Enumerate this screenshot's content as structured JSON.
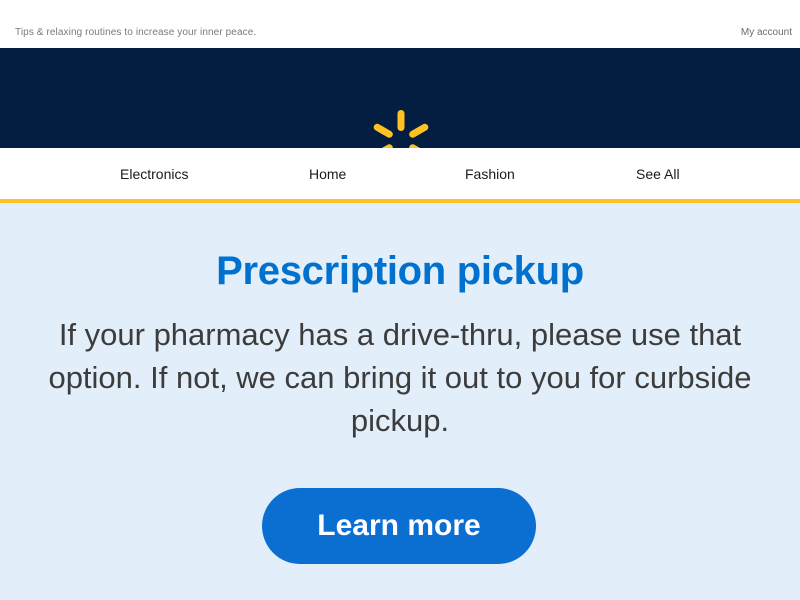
{
  "preheader": {
    "text": "Tips & relaxing routines to increase your inner peace.",
    "account_link": "My account"
  },
  "brand": {
    "logo_icon": "spark-icon",
    "background_color": "#041e42",
    "logo_color": "#ffc220"
  },
  "nav": {
    "accent_color": "#ffc220",
    "items": [
      {
        "label": "Electronics"
      },
      {
        "label": "Home"
      },
      {
        "label": "Fashion"
      },
      {
        "label": "See All"
      }
    ]
  },
  "hero": {
    "title": "Prescription pickup",
    "body": "If your pharmacy has a drive-thru, please use that option. If not, we can bring it out to you for curbside pickup.",
    "cta_label": "Learn more",
    "background_color": "#e2eef9",
    "title_color": "#0071ce",
    "cta_color": "#0a6fd1"
  }
}
